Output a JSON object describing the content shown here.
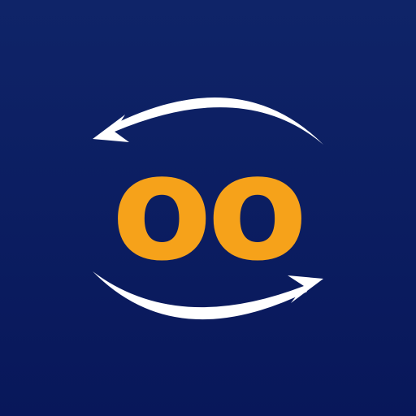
{
  "icon": {
    "logo_text": "oo",
    "arrow_top_icon": "arrow-left-curved-icon",
    "arrow_bottom_icon": "arrow-right-curved-icon"
  },
  "colors": {
    "background_top": "#0f2468",
    "background_bottom": "#08175a",
    "logo_text": "#f6a21a",
    "arrows": "#ffffff"
  }
}
